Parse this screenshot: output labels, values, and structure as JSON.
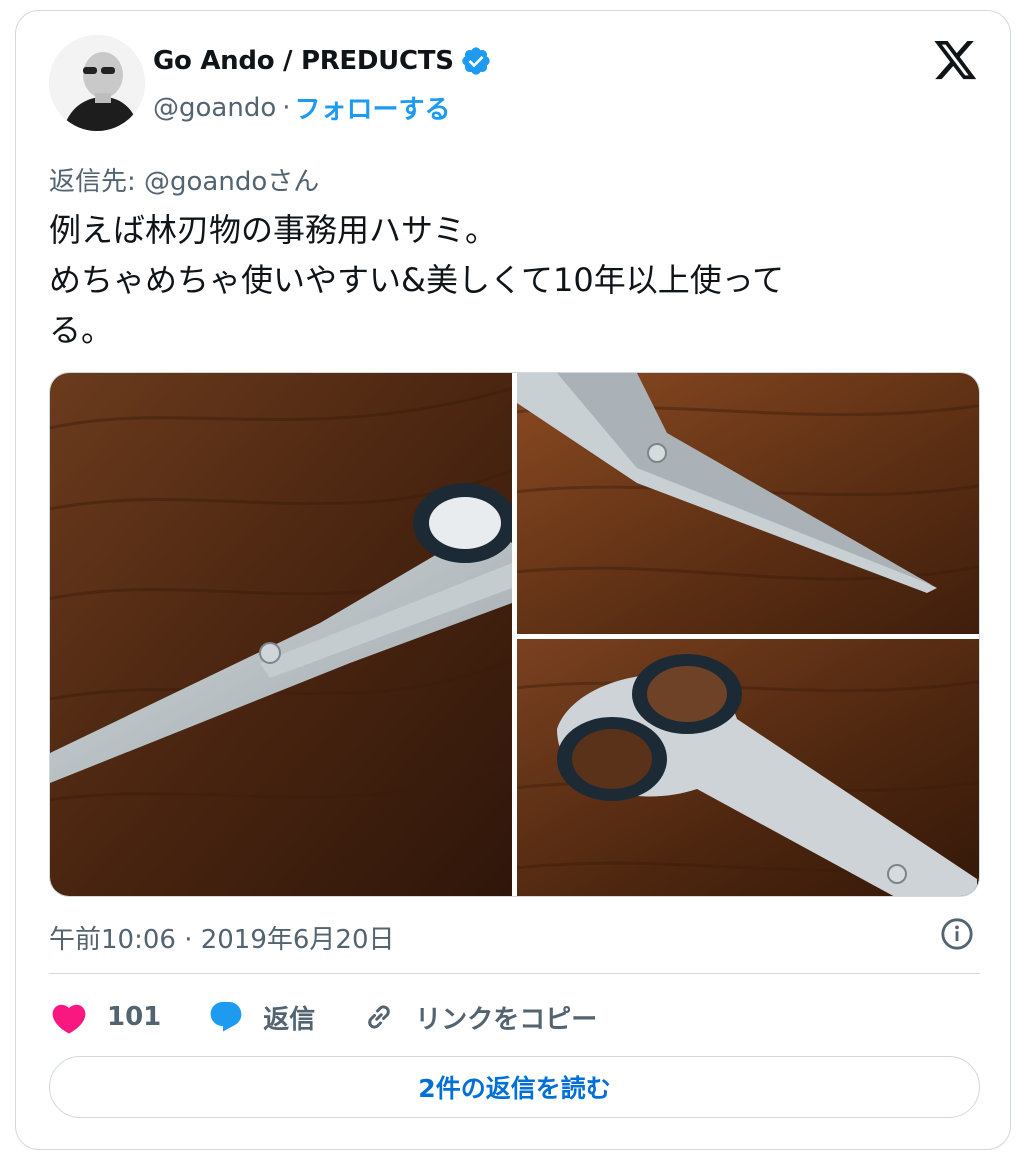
{
  "author": {
    "name": "Go Ando / PREDUCTS",
    "handle": "@goando",
    "separator": "·",
    "follow_label": "フォローする"
  },
  "tweet": {
    "reply_to": "返信先: @goandoさん",
    "text_lines": [
      "例えば林刃物の事務用ハサミ。",
      "めちゃめちゃ使いやすい&美しくて10年以上使って",
      "る。"
    ],
    "timestamp": "午前10:06 · 2019年6月20日"
  },
  "actions": {
    "likes": "101",
    "reply_label": "返信",
    "copy_link_label": "リンクをコピー"
  },
  "read_replies_label": "2件の返信を読む",
  "icons": {
    "logo": "x-logo-icon",
    "verified": "verified-badge-icon",
    "like": "heart-icon",
    "reply": "speech-bubble-icon",
    "link": "link-icon",
    "info": "info-icon"
  },
  "colors": {
    "accent": "#1d9bf0",
    "link_text": "#006fd6",
    "like": "#f91880",
    "secondary_text": "#536471",
    "border": "#cfd9de"
  }
}
